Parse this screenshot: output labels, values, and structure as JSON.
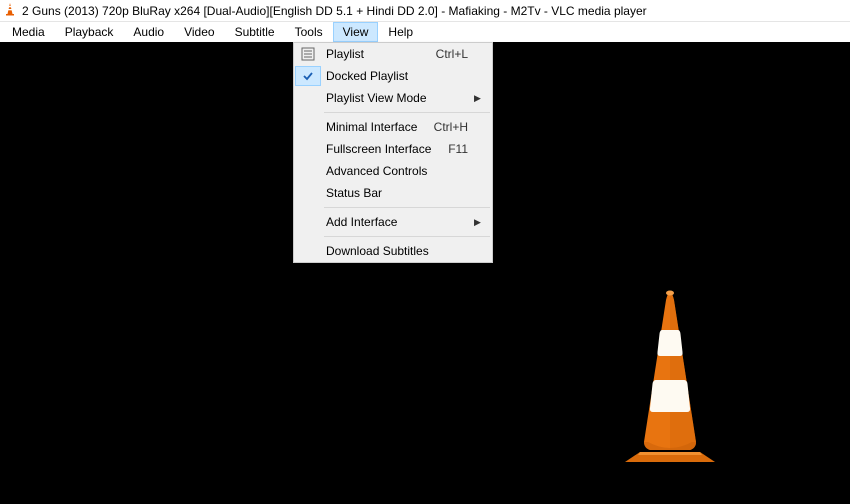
{
  "title": "2 Guns (2013) 720p BluRay x264 [Dual-Audio][English DD 5.1 + Hindi DD 2.0] - Mafiaking - M2Tv - VLC media player",
  "menubar": {
    "items": [
      "Media",
      "Playback",
      "Audio",
      "Video",
      "Subtitle",
      "Tools",
      "View",
      "Help"
    ],
    "active_index": 6
  },
  "dropdown": {
    "items": [
      {
        "label": "Playlist",
        "accel": "Ctrl+L",
        "icon": "playlist",
        "submenu": false
      },
      {
        "label": "Docked Playlist",
        "accel": "",
        "checked": true,
        "submenu": false
      },
      {
        "label": "Playlist View Mode",
        "accel": "",
        "submenu": true
      },
      {
        "sep": true
      },
      {
        "label": "Minimal Interface",
        "accel": "Ctrl+H",
        "submenu": false
      },
      {
        "label": "Fullscreen Interface",
        "accel": "F11",
        "submenu": false
      },
      {
        "label": "Advanced Controls",
        "accel": "",
        "submenu": false
      },
      {
        "label": "Status Bar",
        "accel": "",
        "submenu": false
      },
      {
        "sep": true
      },
      {
        "label": "Add Interface",
        "accel": "",
        "submenu": true
      },
      {
        "sep": true
      },
      {
        "label": "Download Subtitles",
        "accel": "",
        "submenu": false
      }
    ]
  }
}
